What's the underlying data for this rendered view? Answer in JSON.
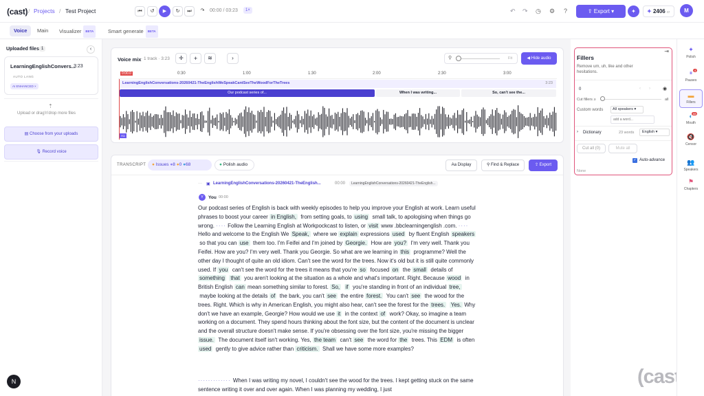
{
  "app": {
    "logo": "(cast)",
    "breadcrumb_projects": "Projects",
    "breadcrumb_sep": "/",
    "project_name": "Test Project",
    "time_display": "00:00 / 03:23",
    "speed": "1×",
    "export_label": "Export",
    "credits": "2406",
    "credits_unit": "cr",
    "avatar": "M",
    "accent": "#6b5bf0"
  },
  "tabs": [
    {
      "label": "Voice"
    },
    {
      "label": "Main"
    },
    {
      "label": "Visualizer",
      "badge": "BETA"
    },
    {
      "label": "Smart generate",
      "badge": "BETA"
    }
  ],
  "left": {
    "title": "Uploaded files",
    "count": "1",
    "file_name": "LearningEnglishConvers...",
    "file_duration": "3:23",
    "tag_auto": "AUTO",
    "tag_lang": "LANG",
    "tag_ai": "AI ENHANCED",
    "tag_ai_x": "×",
    "upload_text": "Upload or drag'n'drop more files",
    "choose_uploads": "Choose from your uploads",
    "record_voice": "Record voice"
  },
  "mix": {
    "title": "Voice mix",
    "subtitle": "· 1 track · 3:23",
    "zoom_fit": "Fit",
    "hide_audio": "Hide audio",
    "time_marks": [
      "0:00.0",
      "0:30",
      "1:00",
      "1:30",
      "2:00",
      "2:30",
      "3:00"
    ],
    "track_name": "LearningEnglishConversations-20260421-TheEnglishWeSpeakCantSeeTheWoodForTheTrees",
    "track_end": "3:23",
    "chapters": [
      "Our podcast series of...",
      "When I was writing...",
      "So, can't see the..."
    ],
    "wave_label": "A1"
  },
  "transcript": {
    "label": "TRANSCRIPT",
    "issues": "Issues",
    "issues_count_a": "8",
    "issues_count_b": "0",
    "issues_count_c": "68",
    "polish": "Polish audio",
    "display": "Display",
    "find_replace": "Find & Replace",
    "export": "Export",
    "file_header": "LearningEnglishConversations-20260421-TheEnglish...",
    "file_time": "00:00",
    "file_chip": "LearningEnglishConversations-20260421-TheEnglish...",
    "speaker_initial": "Y",
    "speaker": "You",
    "speaker_time": "00:00",
    "text_second": "When I was writing my novel, I couldn't see the wood for the trees. I kept getting stuck on the same sentence writing it over and over again. When I was planning my wedding, I just"
  },
  "fillers": {
    "title": "Fillers",
    "desc": "Remove um, uh, like and other hesitations.",
    "count": "0",
    "cut_label": "Cut fillers ≥",
    "cut_value": "all",
    "custom_words": "Custom words",
    "all_speakers": "All speakers",
    "add_word_placeholder": "add a word...",
    "dictionary": "Dictionary",
    "dict_words": "23 words",
    "dict_lang": "English",
    "cut_all": "Cut all (0)",
    "mute_all": "Mute all",
    "auto_advance": "Auto-advance",
    "none": "None",
    "border_color": "#e0537a"
  },
  "rail": [
    {
      "label": "Polish",
      "icon": "sparkle-icon"
    },
    {
      "label": "Pauses",
      "icon": "pause-icon",
      "badge": "4"
    },
    {
      "label": "Fillers",
      "icon": "fillers-icon"
    },
    {
      "label": "Mouth",
      "icon": "mouth-icon",
      "badge": "68"
    },
    {
      "label": "Censor",
      "icon": "censor-icon"
    },
    {
      "label": "Speakers",
      "icon": "speakers-icon"
    },
    {
      "label": "Chapters",
      "icon": "chapters-icon"
    }
  ],
  "watermark": "(cast)",
  "help_avatar": "N"
}
